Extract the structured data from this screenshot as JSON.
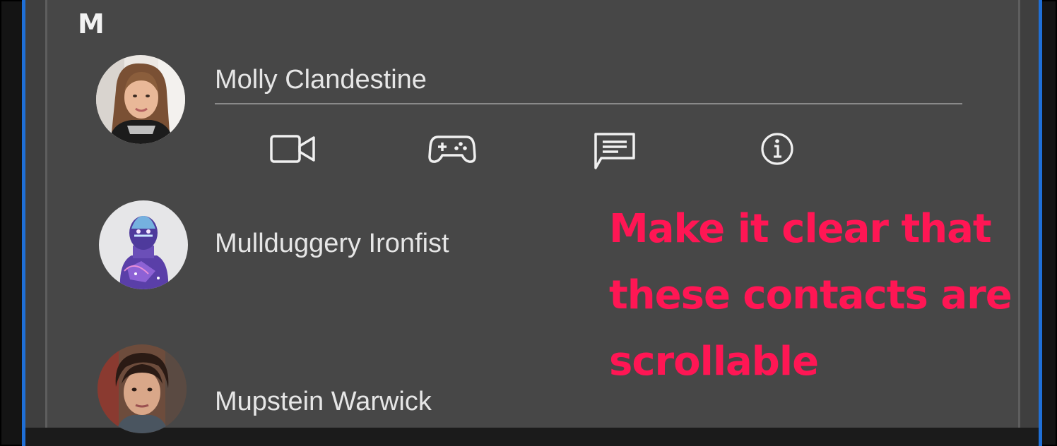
{
  "contacts_section": {
    "group_letter": "M",
    "contacts": [
      {
        "name": "Molly Clandestine",
        "avatar": "photo-avatar-woman",
        "expanded": true,
        "actions": [
          {
            "label": "video-call",
            "icon": "video-camera-icon"
          },
          {
            "label": "game-invite",
            "icon": "gamepad-icon"
          },
          {
            "label": "message",
            "icon": "chat-bubble-icon"
          },
          {
            "label": "info",
            "icon": "info-circle-icon"
          }
        ]
      },
      {
        "name": "Mullduggery Ironfist",
        "avatar": "cosmic-statue-avatar",
        "expanded": false
      },
      {
        "name": "Mupstein Warwick",
        "avatar": "photo-avatar-man",
        "expanded": false
      }
    ]
  },
  "annotation": {
    "lines": [
      "Make it clear that",
      "these contacts are",
      "scrollable"
    ],
    "color": "#ff1654"
  },
  "colors": {
    "panel_bg": "#474747",
    "accent_blue": "#1f6fd6",
    "text": "#e6e6e6"
  }
}
